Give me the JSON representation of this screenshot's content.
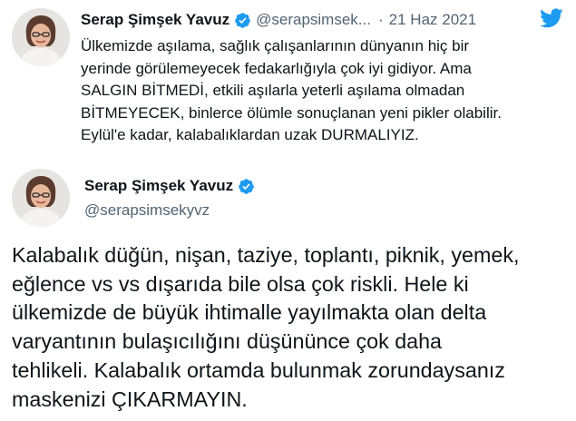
{
  "colors": {
    "accent": "#1d9bf0",
    "text": "#0f1419",
    "secondary": "#536471"
  },
  "tweet_embed": {
    "author_name": "Serap Şimşek Yavuz",
    "handle_truncated": "@serapsimsek...",
    "separator": "·",
    "date": "21 Haz 2021",
    "text": "Ülkemizde aşılama, sağlık çalışanlarının dünyanın hiç bir\nyerinde görülemeyecek fedakarlığıyla çok iyi gidiyor. Ama\nSALGIN BİTMEDİ, etkili aşılarla yeterli aşılama olmadan\nBİTMEYECEK, binlerce ölümle sonuçlanan yeni pikler olabilir.\nEylül'e kadar, kalabalıklardan uzak DURMALIYIZ.",
    "icons": [
      "avatar",
      "verified-badge-icon",
      "twitter-bird-icon"
    ]
  },
  "tweet_main": {
    "author_name": "Serap Şimşek Yavuz",
    "handle": "@serapsimsekyvz",
    "text": "Kalabalık düğün, nişan, taziye, toplantı, piknik, yemek,\neğlence vs vs dışarıda bile olsa çok riskli. Hele ki\nülkemizde de büyük ihtimalle yayılmakta olan delta\nvaryantının bulaşıcılığını düşününce çok daha\ntehlikeli. Kalabalık ortamda bulunmak zorundaysanız\nmaskenizi ÇIKARMAYIN.",
    "icons": [
      "avatar",
      "verified-badge-icon"
    ]
  }
}
